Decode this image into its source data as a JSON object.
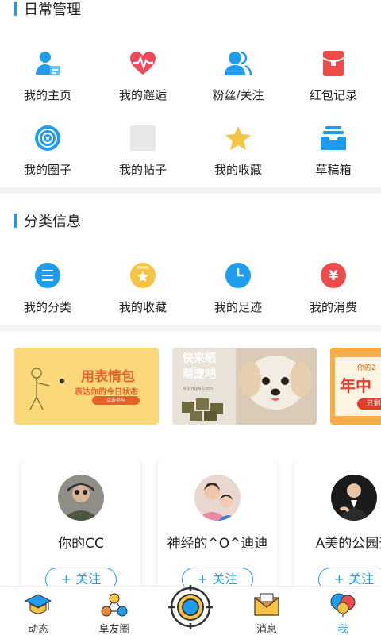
{
  "daily": {
    "title": "日常管理",
    "items": [
      {
        "label": "我的主页",
        "icon": "user-card-icon"
      },
      {
        "label": "我的邂逅",
        "icon": "heartbeat-icon"
      },
      {
        "label": "粉丝/关注",
        "icon": "users-icon"
      },
      {
        "label": "红包记录",
        "icon": "red-envelope-icon"
      },
      {
        "label": "我的圈子",
        "icon": "circle-target-icon"
      },
      {
        "label": "我的帖子",
        "icon": "post-placeholder-icon"
      },
      {
        "label": "我的收藏",
        "icon": "star-icon"
      },
      {
        "label": "草稿箱",
        "icon": "inbox-tray-icon"
      }
    ]
  },
  "category": {
    "title": "分类信息",
    "items": [
      {
        "label": "我的分类",
        "icon": "list-icon"
      },
      {
        "label": "我的收藏",
        "icon": "star-folder-icon"
      },
      {
        "label": "我的足迹",
        "icon": "clock-icon"
      },
      {
        "label": "我的消费",
        "icon": "yen-icon"
      }
    ]
  },
  "banners": [
    {
      "title": "用表情包",
      "subtitle": "表达你的今日状态",
      "button": "点击参与"
    },
    {
      "title": "快来晒\n萌宠吧",
      "watermark": "ebmiye.com"
    },
    {
      "title": "年中",
      "top": "你的2",
      "pill": "只剩半"
    }
  ],
  "users": [
    {
      "name": "你的CC",
      "follow": "+ 关注"
    },
    {
      "name": "神经的^O^迪迪",
      "follow": "+ 关注"
    },
    {
      "name": "A美的公园天",
      "follow": "+ 关注"
    }
  ],
  "tabbar": [
    {
      "label": "动态",
      "icon": "graduation-cap-icon"
    },
    {
      "label": "阜友圈",
      "icon": "friends-network-icon"
    },
    {
      "label": "",
      "icon": "center-target-icon"
    },
    {
      "label": "消息",
      "icon": "envelope-icon"
    },
    {
      "label": "我",
      "icon": "profile-balloon-icon"
    }
  ],
  "colors": {
    "accent": "#1e9cf0",
    "red": "#f04a4a",
    "yellow": "#f6c342"
  }
}
